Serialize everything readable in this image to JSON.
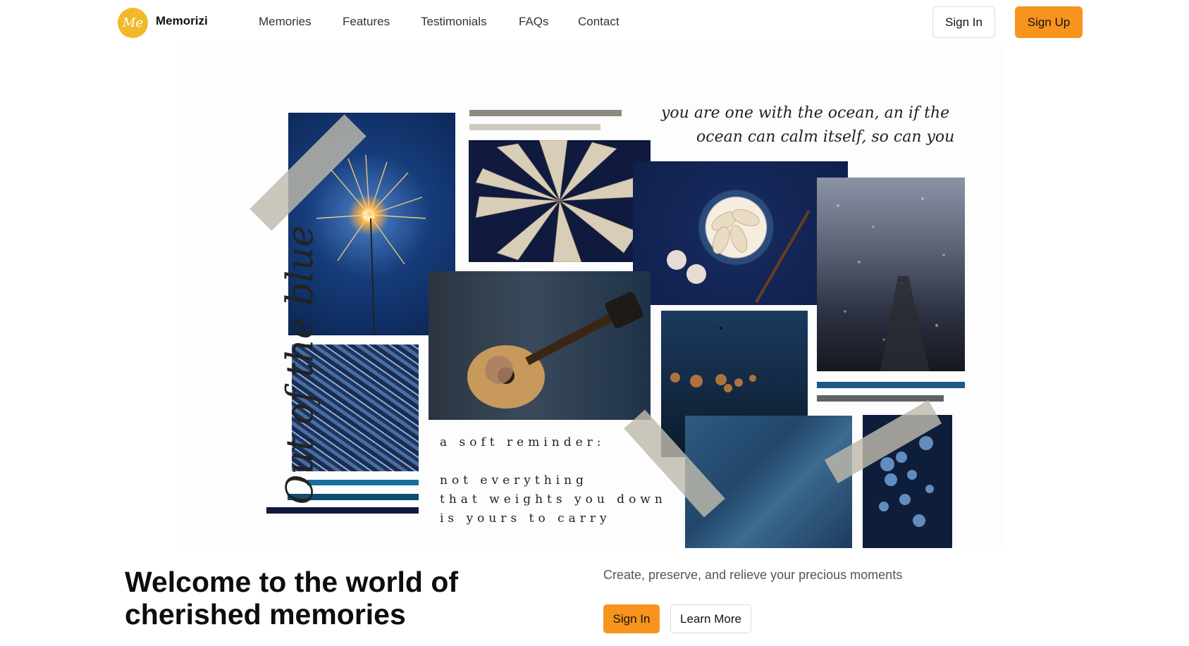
{
  "brand": {
    "logo_text": "Me",
    "name": "Memorizi"
  },
  "nav": {
    "links": [
      "Memories",
      "Features",
      "Testimonials",
      "FAQs",
      "Contact"
    ],
    "sign_in": "Sign In",
    "sign_up": "Sign Up"
  },
  "collage": {
    "vertical_script": "Out of the blue",
    "quote_line1": "you are one with the ocean, an if the",
    "quote_line2": "ocean can calm itself, so can you",
    "reminder": [
      "a soft reminder:",
      "not everything",
      "that weights you down",
      "is yours to carry"
    ]
  },
  "hero": {
    "title": "Welcome to the world of cherished memories",
    "subtitle": "Create, preserve, and relieve your precious moments",
    "primary_button": "Sign In",
    "secondary_button": "Learn More"
  },
  "colors": {
    "accent": "#f7941d",
    "logo": "#f1b82a",
    "navy": "#0f2a5c",
    "steel_blue": "#1e5a86"
  }
}
